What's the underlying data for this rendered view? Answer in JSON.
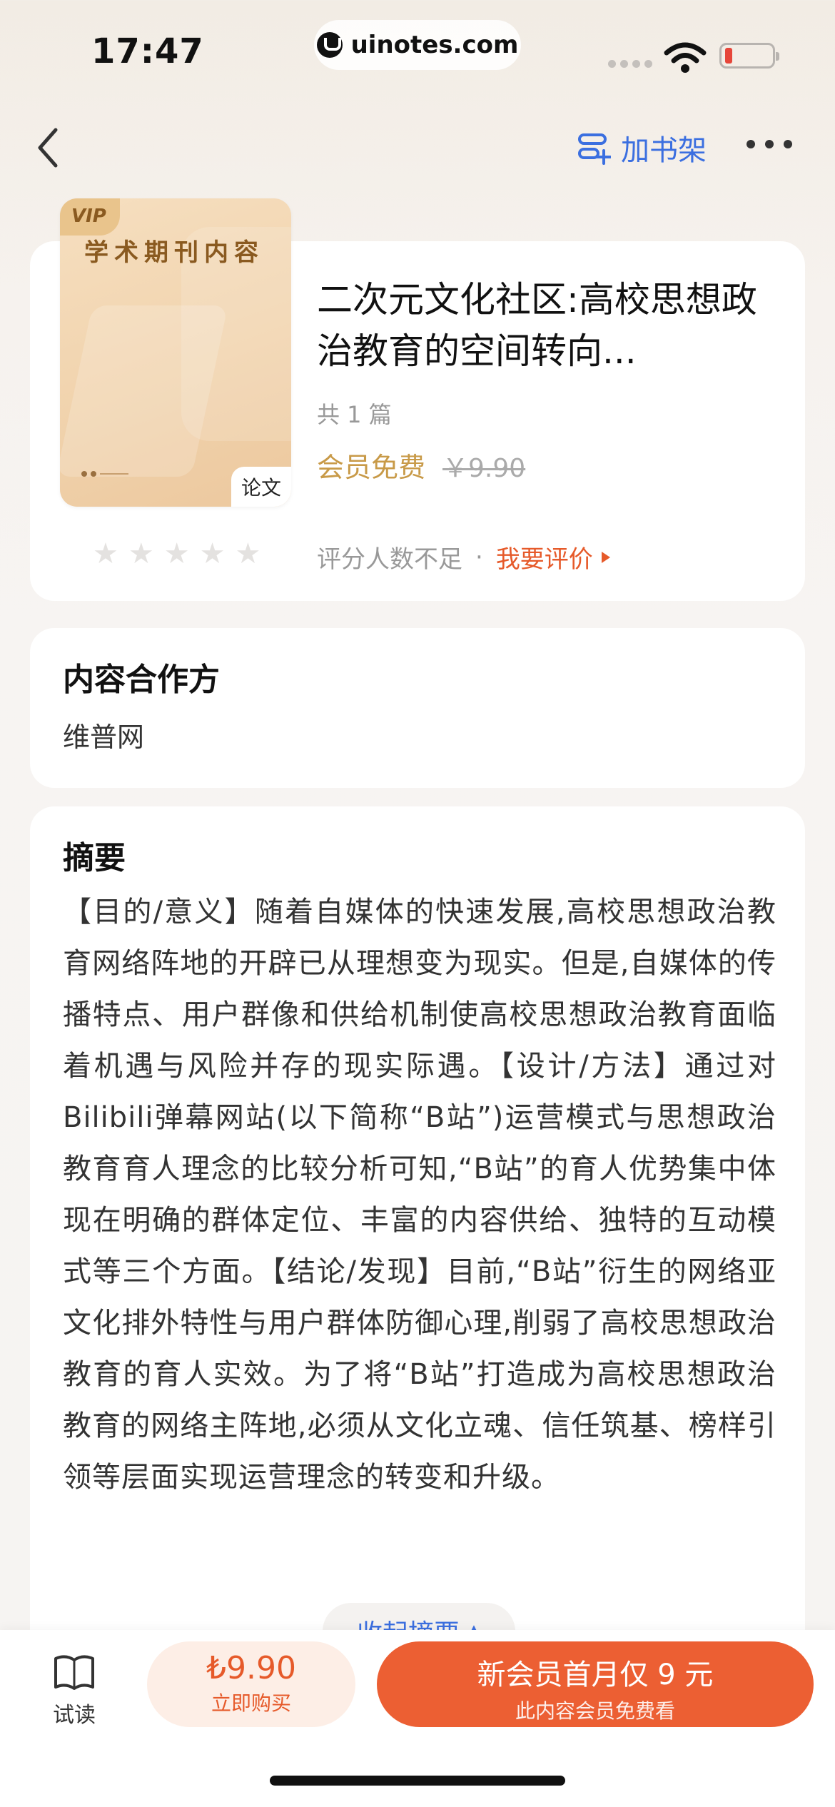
{
  "status_bar": {
    "time": "17:47",
    "url": "uinotes.com"
  },
  "nav": {
    "add_shelf_label": "加书架"
  },
  "book": {
    "cover": {
      "vip_badge": "VIP",
      "title": "学术期刊内容",
      "tag": "论文"
    },
    "title": "二次元文化社区:高校思想政治教育的空间转向...",
    "count": "共 1 篇",
    "member_free": "会员免费",
    "original_price": "￥9.90",
    "rating_stars": 0,
    "rating_note": "评分人数不足",
    "rating_separator": "·",
    "rate_link": "我要评价"
  },
  "partner": {
    "title": "内容合作方",
    "name": "维普网"
  },
  "abstract": {
    "title": "摘要",
    "text": "【目的/意义】随着自媒体的快速发展,高校思想政治教育网络阵地的开辟已从理想变为现实。但是,自媒体的传播特点、用户群像和供给机制使高校思想政治教育面临着机遇与风险并存的现实际遇。【设计/方法】通过对Bilibili弹幕网站(以下简称“B站”)运营模式与思想政治教育育人理念的比较分析可知,“B站”的育人优势集中体现在明确的群体定位、丰富的内容供给、独特的互动模式等三个方面。【结论/发现】目前,“B站”衍生的网络亚文化排外特性与用户群体防御心理,削弱了高校思想政治教育的育人实效。为了将“B站”打造成为高校思想政治教育的网络主阵地,必须从文化立魂、信任筑基、榜样引领等层面实现运营理念的转变和升级。",
    "collapse_label": "收起摘要"
  },
  "bottom_bar": {
    "trial_label": "试读",
    "buy_price": "₺9.90",
    "buy_label": "立即购买",
    "member_main": "新会员首月仅 9 元",
    "member_sub": "此内容会员免费看"
  },
  "colors": {
    "accent_blue": "#3b6fe0",
    "accent_orange": "#ec5f33",
    "gold": "#c89a48"
  }
}
